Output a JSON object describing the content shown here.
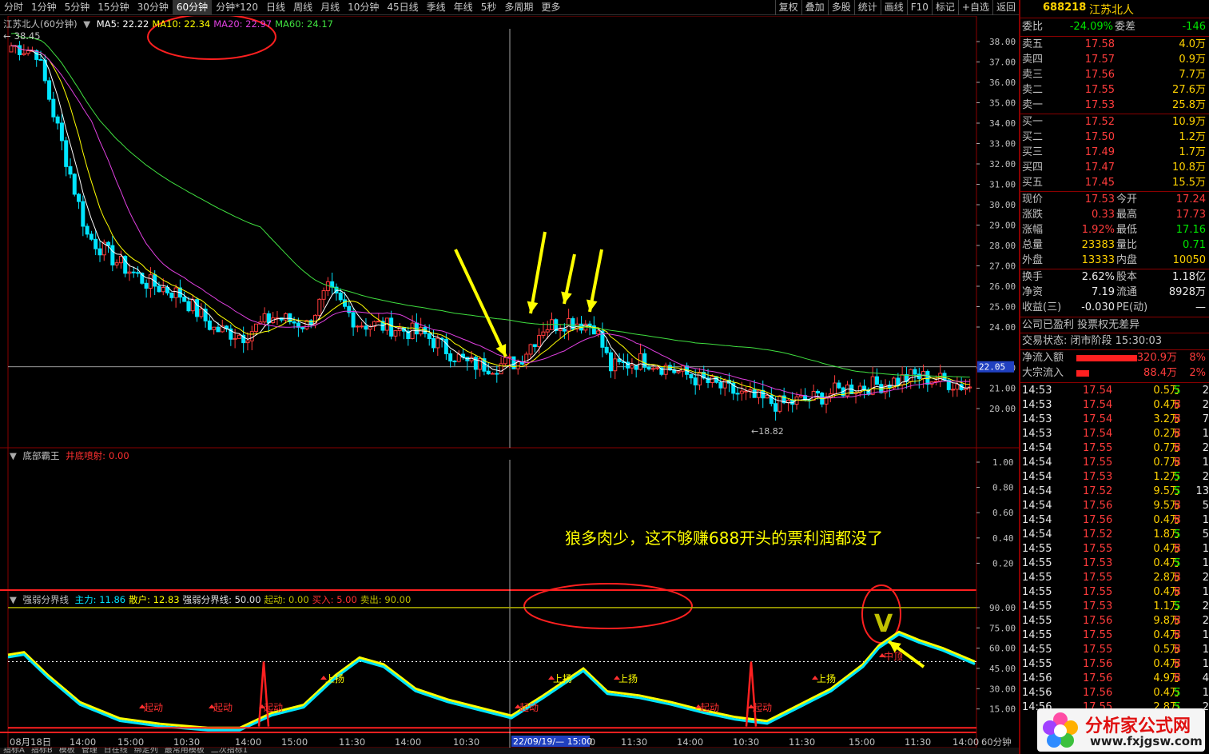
{
  "toolbar": {
    "periods": [
      "分时",
      "1分钟",
      "5分钟",
      "15分钟",
      "30分钟",
      "60分钟",
      "分钟*120",
      "日线",
      "周线",
      "月线",
      "10分钟",
      "45日线",
      "季线",
      "年线",
      "5秒",
      "多周期",
      "更多"
    ],
    "active_period": "60分钟",
    "tools": [
      "复权",
      "叠加",
      "多股",
      "统计",
      "画线",
      "F10",
      "标记",
      "+自选",
      "返回"
    ]
  },
  "main_chart": {
    "title": "江苏北人(60分钟)",
    "ma_legend": [
      {
        "label": "MA5: 22.22",
        "color": "#ffffff"
      },
      {
        "label": "MA10: 22.34",
        "color": "#ffff00"
      },
      {
        "label": "MA20: 22.97",
        "color": "#e040e0"
      },
      {
        "label": "MA60: 24.17",
        "color": "#40e040"
      }
    ],
    "high_label": "38.45",
    "low_label": "18.82",
    "price_ticks": [
      "38.00",
      "37.00",
      "36.00",
      "35.00",
      "34.00",
      "33.00",
      "32.00",
      "31.00",
      "30.00",
      "29.00",
      "28.00",
      "27.00",
      "26.00",
      "25.00",
      "24.00",
      "22.00",
      "21.00",
      "20.00"
    ],
    "cursor_price": "22.05"
  },
  "indicator1": {
    "name": "底部霸王",
    "param_label": "井底喷射:",
    "param_value": "0.00",
    "ticks": [
      "1.00",
      "0.80",
      "0.60",
      "0.40",
      "0.20"
    ],
    "annotation": "狼多肉少，这不够赚688开头的票利润都没了"
  },
  "indicator2": {
    "name": "强弱分界线",
    "legend": [
      {
        "label": "主力:",
        "value": "11.86",
        "color": "#00e5ff"
      },
      {
        "label": "散户:",
        "value": "12.83",
        "color": "#ffff00"
      },
      {
        "label": "强弱分界线:",
        "value": "50.00",
        "color": "#e0e0e0"
      },
      {
        "label": "起动:",
        "value": "0.00",
        "color": "#c0c000"
      },
      {
        "label": "买入:",
        "value": "5.00",
        "color": "#ff3030"
      },
      {
        "label": "卖出:",
        "value": "90.00",
        "color": "#c0c000"
      }
    ],
    "ticks": [
      "90.00",
      "75.00",
      "60.00",
      "45.00",
      "30.00",
      "15.00"
    ],
    "signals": [
      "起动",
      "起动",
      "起动",
      "上扬",
      "起动",
      "上扬",
      "上扬",
      "起动",
      "起动",
      "上扬",
      "中顶"
    ],
    "v_mark": "V"
  },
  "time_axis": {
    "labels": [
      "08月18日",
      "14:00",
      "15:00",
      "10:30",
      "14:00",
      "15:00",
      "11:30",
      "14:00",
      "10:30",
      "11:30",
      "14:00",
      "11:30",
      "14:00",
      "10:30",
      "11:30",
      "15:00",
      "11:30",
      "14:00"
    ],
    "cursor_label": "22/09/19/— 15:00",
    "period_label": "60分钟"
  },
  "bottom_tabs": [
    "指标A",
    "指标B",
    "模板",
    "管理",
    "日在线",
    "绑定列",
    "最常用模板",
    "二次指标1"
  ],
  "quote_panel": {
    "code": "688218",
    "name": "江苏北人",
    "wei_bi_label": "委比",
    "wei_bi": "-24.09%",
    "wei_cha_label": "委差",
    "wei_cha": "-146",
    "asks": [
      {
        "label": "卖五",
        "price": "17.58",
        "vol": "4.0万"
      },
      {
        "label": "卖四",
        "price": "17.57",
        "vol": "0.9万"
      },
      {
        "label": "卖三",
        "price": "17.56",
        "vol": "7.7万"
      },
      {
        "label": "卖二",
        "price": "17.55",
        "vol": "27.6万"
      },
      {
        "label": "卖一",
        "price": "17.53",
        "vol": "25.8万"
      }
    ],
    "bids": [
      {
        "label": "买一",
        "price": "17.52",
        "vol": "10.9万"
      },
      {
        "label": "买二",
        "price": "17.50",
        "vol": "1.2万"
      },
      {
        "label": "买三",
        "price": "17.49",
        "vol": "1.7万"
      },
      {
        "label": "买四",
        "price": "17.47",
        "vol": "10.8万"
      },
      {
        "label": "买五",
        "price": "17.45",
        "vol": "15.5万"
      }
    ],
    "stats": [
      {
        "l1": "现价",
        "v1": "17.53",
        "c1": "red",
        "l2": "今开",
        "v2": "17.24",
        "c2": "red"
      },
      {
        "l1": "涨跌",
        "v1": "0.33",
        "c1": "red",
        "l2": "最高",
        "v2": "17.73",
        "c2": "red"
      },
      {
        "l1": "涨幅",
        "v1": "1.92%",
        "c1": "red",
        "l2": "最低",
        "v2": "17.16",
        "c2": "green"
      },
      {
        "l1": "总量",
        "v1": "23383",
        "c1": "yellow",
        "l2": "量比",
        "v2": "0.71",
        "c2": "green"
      },
      {
        "l1": "外盘",
        "v1": "13333",
        "c1": "yellow",
        "l2": "内盘",
        "v2": "10050",
        "c2": "yellow"
      }
    ],
    "stats2": [
      {
        "l1": "换手",
        "v1": "2.62%",
        "l2": "股本",
        "v2": "1.18亿"
      },
      {
        "l1": "净资",
        "v1": "7.19",
        "l2": "流通",
        "v2": "8928万"
      },
      {
        "l1": "收益(三)",
        "v1": "-0.030",
        "l2": "PE(动)",
        "v2": "—"
      }
    ],
    "company_note": "公司已盈利 投票权无差异",
    "trade_status": "交易状态: 闭市阶段 15:30:03",
    "net_inflow_label": "净流入额",
    "net_inflow": "320.9万",
    "net_inflow_pct": "8%",
    "block_inflow_label": "大宗流入",
    "block_inflow": "88.4万",
    "block_inflow_pct": "2%",
    "ticks": [
      {
        "time": "14:53",
        "price": "17.54",
        "vol": "0.5万",
        "side": "S",
        "n": "2"
      },
      {
        "time": "14:53",
        "price": "17.54",
        "vol": "0.4万",
        "side": "B",
        "n": "2"
      },
      {
        "time": "14:53",
        "price": "17.54",
        "vol": "3.2万",
        "side": "B",
        "n": "7"
      },
      {
        "time": "14:53",
        "price": "17.54",
        "vol": "0.2万",
        "side": "B",
        "n": "1"
      },
      {
        "time": "14:54",
        "price": "17.55",
        "vol": "0.7万",
        "side": "B",
        "n": "2"
      },
      {
        "time": "14:54",
        "price": "17.55",
        "vol": "0.7万",
        "side": "B",
        "n": "1"
      },
      {
        "time": "14:54",
        "price": "17.53",
        "vol": "1.2万",
        "side": "S",
        "n": "2"
      },
      {
        "time": "14:54",
        "price": "17.52",
        "vol": "9.5万",
        "side": "S",
        "n": "13"
      },
      {
        "time": "14:54",
        "price": "17.56",
        "vol": "9.5万",
        "side": "B",
        "n": "5"
      },
      {
        "time": "14:54",
        "price": "17.56",
        "vol": "0.4万",
        "side": "B",
        "n": "1"
      },
      {
        "time": "14:54",
        "price": "17.52",
        "vol": "1.8万",
        "side": "S",
        "n": "5"
      },
      {
        "time": "14:55",
        "price": "17.55",
        "vol": "0.4万",
        "side": "B",
        "n": "1"
      },
      {
        "time": "14:55",
        "price": "17.53",
        "vol": "0.4万",
        "side": "S",
        "n": "1"
      },
      {
        "time": "14:55",
        "price": "17.55",
        "vol": "2.8万",
        "side": "B",
        "n": "2"
      },
      {
        "time": "14:55",
        "price": "17.55",
        "vol": "0.4万",
        "side": "B",
        "n": "1"
      },
      {
        "time": "14:55",
        "price": "17.53",
        "vol": "1.1万",
        "side": "S",
        "n": "2"
      },
      {
        "time": "14:55",
        "price": "17.56",
        "vol": "9.8万",
        "side": "B",
        "n": "2"
      },
      {
        "time": "14:55",
        "price": "17.55",
        "vol": "0.4万",
        "side": "B",
        "n": "1"
      },
      {
        "time": "14:55",
        "price": "17.55",
        "vol": "0.5万",
        "side": "B",
        "n": "1"
      },
      {
        "time": "14:55",
        "price": "17.56",
        "vol": "0.4万",
        "side": "B",
        "n": "1"
      },
      {
        "time": "14:56",
        "price": "17.56",
        "vol": "4.9万",
        "side": "B",
        "n": "4"
      },
      {
        "time": "14:56",
        "price": "17.56",
        "vol": "0.4万",
        "side": "S",
        "n": "1"
      },
      {
        "time": "14:56",
        "price": "17.55",
        "vol": "2.8万",
        "side": "S",
        "n": "2"
      }
    ]
  },
  "watermark": {
    "title": "分析家公式网",
    "url": "www.fxjgsw.com"
  },
  "colors": {
    "up": "#ff3c3c",
    "down": "#00e5ff",
    "frame": "#8a0000",
    "annotation": "#ffff00"
  }
}
